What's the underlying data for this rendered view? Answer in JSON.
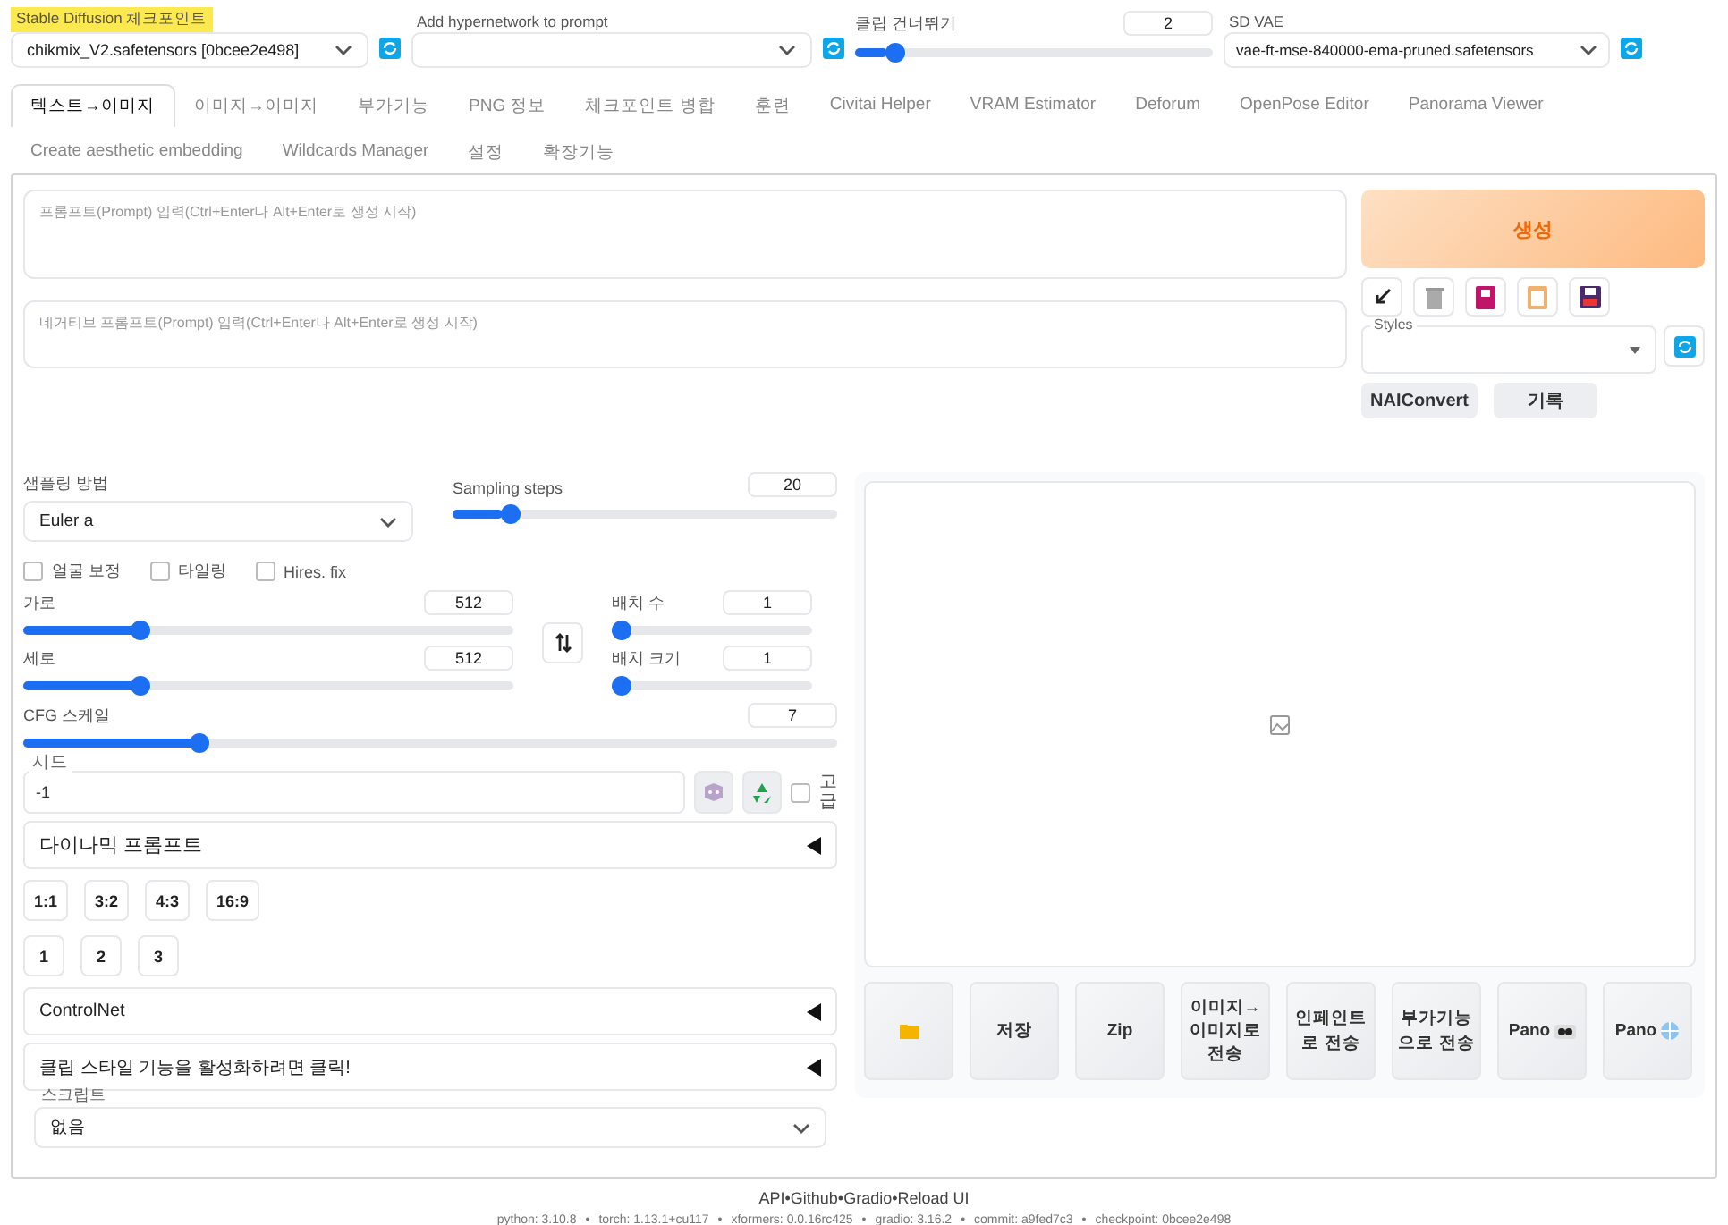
{
  "top": {
    "checkpoint": {
      "label": "Stable Diffusion 체크포인트",
      "value": "chikmix_V2.safetensors [0bcee2e498]",
      "highlighted": true
    },
    "hypernetwork": {
      "label": "Add hypernetwork to prompt"
    },
    "clip_skip": {
      "label": "클립 건너뛰기",
      "value": "2",
      "level": 0.09
    },
    "vae": {
      "label": "SD VAE",
      "value": "vae-ft-mse-840000-ema-pruned.safetensors"
    }
  },
  "tabs": [
    {
      "label": "텍스트→이미지",
      "selected": true
    },
    {
      "label": "이미지→이미지",
      "selected": false
    },
    {
      "label": "부가기능",
      "selected": false
    },
    {
      "label": "PNG 정보",
      "selected": false
    },
    {
      "label": "체크포인트 병합",
      "selected": false
    },
    {
      "label": "훈련",
      "selected": false
    },
    {
      "label": "Civitai Helper",
      "selected": false
    },
    {
      "label": "VRAM Estimator",
      "selected": false
    },
    {
      "label": "Deforum",
      "selected": false
    },
    {
      "label": "OpenPose Editor",
      "selected": false
    },
    {
      "label": "Panorama Viewer",
      "selected": false
    },
    {
      "label": "Create aesthetic embedding",
      "selected": false
    },
    {
      "label": "Wildcards Manager",
      "selected": false
    },
    {
      "label": "설정",
      "selected": false
    },
    {
      "label": "확장기능",
      "selected": false
    }
  ],
  "prompt": {
    "placeholder": "프롬프트(Prompt) 입력(Ctrl+Enter나 Alt+Enter로 생성 시작)"
  },
  "negative_prompt": {
    "placeholder": "네거티브 프롬프트(Prompt) 입력(Ctrl+Enter나 Alt+Enter로 생성 시작)"
  },
  "generate": {
    "label": "생성"
  },
  "tool_buttons": [
    {
      "kind": "paste"
    },
    {
      "kind": "trash"
    },
    {
      "kind": "card"
    },
    {
      "kind": "clipboard"
    },
    {
      "kind": "save"
    }
  ],
  "styles": {
    "label": "Styles"
  },
  "extra_buttons": [
    "NAIConvert",
    "기록"
  ],
  "sampler": {
    "label": "샘플링 방법",
    "value": "Euler a"
  },
  "sampling_steps": {
    "label": "Sampling steps",
    "value": "20",
    "level": 0.13
  },
  "checkboxes": [
    {
      "label": "얼굴 보정",
      "checked": false
    },
    {
      "label": "타일링",
      "checked": false
    },
    {
      "label": "Hires. fix",
      "checked": false
    }
  ],
  "width": {
    "label": "가로",
    "value": "512",
    "level": 0.23
  },
  "height": {
    "label": "세로",
    "value": "512",
    "level": 0.23
  },
  "batch_count": {
    "label": "배치 수",
    "value": "1",
    "level": 0.0
  },
  "batch_size": {
    "label": "배치 크기",
    "value": "1",
    "level": 0.0
  },
  "cfg": {
    "label": "CFG 스케일",
    "value": "7",
    "level": 0.21
  },
  "seed": {
    "label": "시드",
    "value": "-1",
    "extra_label": "고급",
    "extra_checked": false
  },
  "accordions_top": [
    {
      "label": "다이나믹 프롬프트",
      "expanded": false
    }
  ],
  "aspect_buttons": [
    "1:1",
    "3:2",
    "4:3",
    "16:9"
  ],
  "count_buttons": [
    "1",
    "2",
    "3"
  ],
  "accordions": [
    {
      "label": "ControlNet",
      "expanded": false
    },
    {
      "label": "클립 스타일 기능을 활성화하려면 클릭!",
      "expanded": false
    }
  ],
  "script": {
    "label": "스크립트",
    "value": "없음"
  },
  "output_buttons": [
    {
      "kind": "folder"
    },
    {
      "kind": "text",
      "label": "저장"
    },
    {
      "kind": "text",
      "label": "Zip"
    },
    {
      "kind": "text",
      "label": "이미지→이미지로 전송"
    },
    {
      "kind": "text",
      "label": "인페인트로 전송"
    },
    {
      "kind": "text",
      "label": "부가기능으로 전송"
    },
    {
      "kind": "eyes",
      "label": "Pano"
    },
    {
      "kind": "globe",
      "label": "Pano"
    }
  ],
  "footer": {
    "links": [
      "API",
      "Github",
      "Gradio",
      "Reload UI"
    ],
    "separator": "•",
    "versions": [
      "python: 3.10.8",
      "torch: 1.13.1+cu117",
      "xformers: 0.0.16rc425",
      "gradio: 3.16.2",
      "commit: a9fed7c3",
      "checkpoint: 0bcee2e498"
    ]
  }
}
